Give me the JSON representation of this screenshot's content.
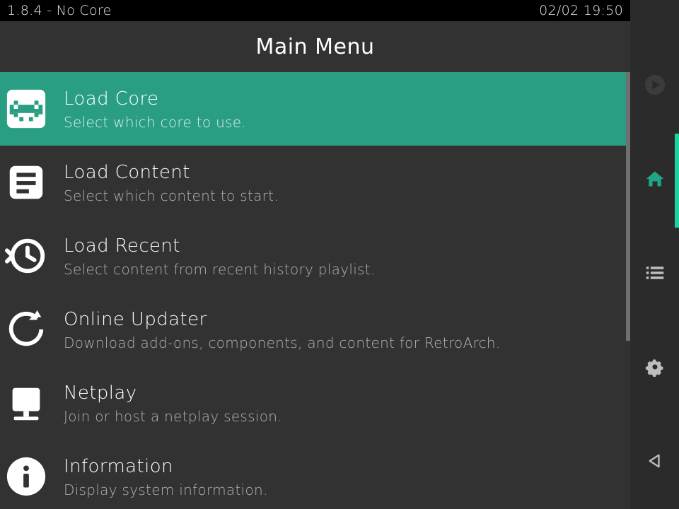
{
  "statusbar": {
    "left": "1.8.4 - No Core",
    "right": "02/02 19:50"
  },
  "title": "Main Menu",
  "menu": [
    {
      "id": "load-core",
      "label": "Load Core",
      "sublabel": "Select which core to use.",
      "icon": "invader",
      "selected": true
    },
    {
      "id": "load-content",
      "label": "Load Content",
      "sublabel": "Select which content to start.",
      "icon": "document",
      "selected": false
    },
    {
      "id": "load-recent",
      "label": "Load Recent",
      "sublabel": "Select content from recent history playlist.",
      "icon": "history",
      "selected": false
    },
    {
      "id": "online-updater",
      "label": "Online Updater",
      "sublabel": "Download add-ons, components, and content for RetroArch.",
      "icon": "refresh",
      "selected": false
    },
    {
      "id": "netplay",
      "label": "Netplay",
      "sublabel": "Join or host a netplay session.",
      "icon": "monitor",
      "selected": false
    },
    {
      "id": "information",
      "label": "Information",
      "sublabel": "Display system information.",
      "icon": "info",
      "selected": false
    }
  ],
  "sidebar": [
    {
      "id": "play",
      "icon": "play"
    },
    {
      "id": "home",
      "icon": "home",
      "active": true
    },
    {
      "id": "list",
      "icon": "list"
    },
    {
      "id": "settings",
      "icon": "gear"
    },
    {
      "id": "back",
      "icon": "back"
    }
  ],
  "colors": {
    "accent": "#299e82",
    "accent_bright": "#1dd3a2",
    "bg": "#323232",
    "sidebar_bg": "#2b2b2b"
  }
}
